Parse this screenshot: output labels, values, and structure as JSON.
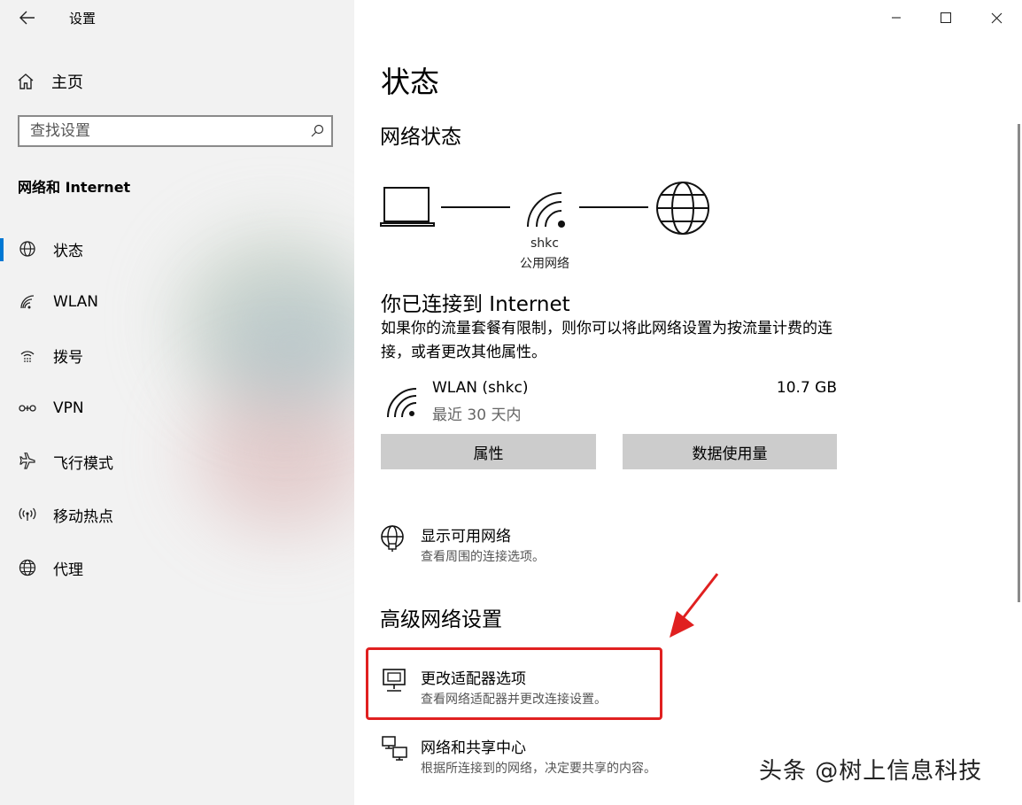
{
  "window": {
    "title": "设置",
    "controls": [
      "minimize-icon",
      "maximize-icon",
      "close-icon"
    ]
  },
  "sidebar": {
    "home_label": "主页",
    "search_placeholder": "查找设置",
    "section_title": "网络和 Internet",
    "items": [
      {
        "label": "状态",
        "icon": "globe-status-icon",
        "active": true
      },
      {
        "label": "WLAN",
        "icon": "wifi-icon",
        "active": false
      },
      {
        "label": "拨号",
        "icon": "dialup-icon",
        "active": false
      },
      {
        "label": "VPN",
        "icon": "vpn-icon",
        "active": false
      },
      {
        "label": "飞行模式",
        "icon": "airplane-icon",
        "active": false
      },
      {
        "label": "移动热点",
        "icon": "hotspot-icon",
        "active": false
      },
      {
        "label": "代理",
        "icon": "globe-icon",
        "active": false
      }
    ],
    "accent_color": "#0078d4"
  },
  "main": {
    "page_title": "状态",
    "network_status_title": "网络状态",
    "network_diagram": {
      "network_name": "shkc",
      "network_type": "公用网络"
    },
    "connected_title": "你已连接到 Internet",
    "connected_desc": "如果你的流量套餐有限制，则你可以将此网络设置为按流量计费的连接，或者更改其他属性。",
    "connection": {
      "name": "WLAN (shkc)",
      "period": "最近 30 天内",
      "usage": "10.7 GB"
    },
    "buttons": {
      "properties": "属性",
      "data_usage": "数据使用量"
    },
    "show_networks": {
      "title": "显示可用网络",
      "desc": "查看周围的连接选项。"
    },
    "advanced_title": "高级网络设置",
    "adapter_options": {
      "title": "更改适配器选项",
      "desc": "查看网络适配器并更改连接设置。"
    },
    "sharing_center": {
      "title": "网络和共享中心",
      "desc": "根据所连接到的网络，决定要共享的内容。"
    },
    "annotation_color": "#e02020"
  },
  "watermark": "头条 @树上信息科技"
}
